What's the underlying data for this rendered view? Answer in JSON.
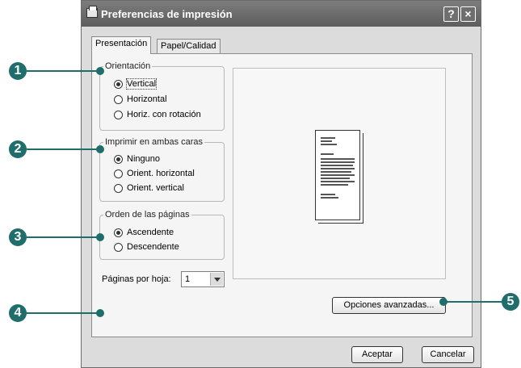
{
  "window": {
    "title": "Preferencias de impresión",
    "help_button": "?",
    "close_button": "×"
  },
  "tabs": [
    {
      "label": "Presentación",
      "active": true
    },
    {
      "label": "Papel/Calidad",
      "active": false
    }
  ],
  "orientation": {
    "legend": "Orientación",
    "options": [
      {
        "label": "Vertical",
        "selected": true
      },
      {
        "label": "Horizontal",
        "selected": false
      },
      {
        "label": "Horiz. con rotación",
        "selected": false
      }
    ]
  },
  "duplex": {
    "legend": "Imprimir en ambas caras",
    "options": [
      {
        "label": "Ninguno",
        "selected": true
      },
      {
        "label": "Orient. horizontal",
        "selected": false
      },
      {
        "label": "Orient. vertical",
        "selected": false
      }
    ]
  },
  "page_order": {
    "legend": "Orden de las páginas",
    "options": [
      {
        "label": "Ascendente",
        "selected": true
      },
      {
        "label": "Descendente",
        "selected": false
      }
    ]
  },
  "pages_per_sheet": {
    "label": "Páginas por hoja:",
    "value": "1"
  },
  "buttons": {
    "advanced": "Opciones avanzadas...",
    "accept": "Aceptar",
    "cancel": "Cancelar"
  },
  "callouts": [
    "1",
    "2",
    "3",
    "4",
    "5"
  ],
  "colors": {
    "callout": "#1f6e6c",
    "titlebar": "#6d6d6d"
  }
}
